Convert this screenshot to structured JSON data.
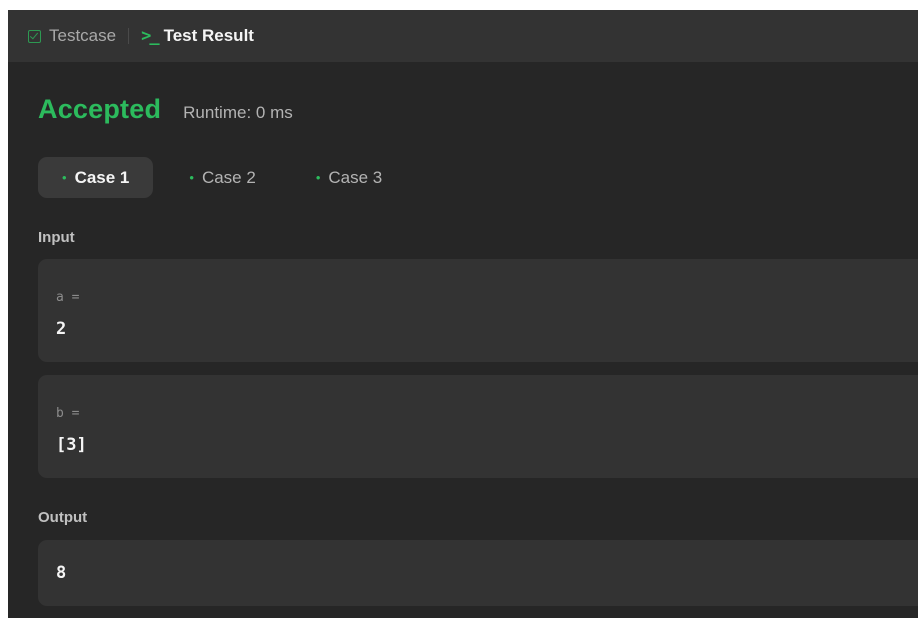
{
  "tabs": {
    "testcase_label": "Testcase",
    "result_label": "Test Result"
  },
  "result": {
    "status": "Accepted",
    "runtime": "Runtime: 0 ms"
  },
  "cases": [
    {
      "label": "Case 1",
      "active": true
    },
    {
      "label": "Case 2",
      "active": false
    },
    {
      "label": "Case 3",
      "active": false
    }
  ],
  "input": {
    "label": "Input",
    "params": [
      {
        "name": "a =",
        "value": "2"
      },
      {
        "name": "b =",
        "value": "[3]"
      }
    ]
  },
  "output": {
    "label": "Output",
    "value": "8"
  },
  "icons": {
    "testcase": "checkbox-icon",
    "result": "terminal-icon",
    "case_status": "dot-icon"
  },
  "colors": {
    "accent": "#2cbb5d",
    "panel": "#262626",
    "tabbar": "#333333",
    "box": "#333333"
  }
}
